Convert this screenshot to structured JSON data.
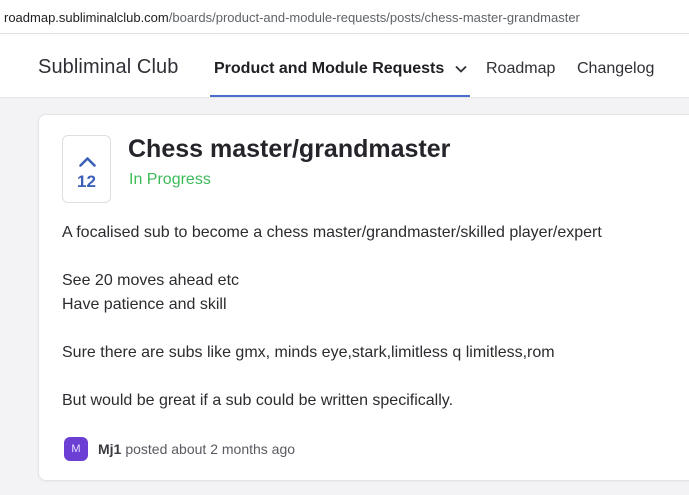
{
  "browser": {
    "url_host": "roadmap.subliminalclub.com",
    "url_path": "/boards/product-and-module-requests/posts/chess-master-grandmaster"
  },
  "nav": {
    "brand": "Subliminal Club",
    "items": [
      {
        "label": "Product and Module Requests",
        "active": true,
        "icon": "chevron-down-icon"
      },
      {
        "label": "Roadmap",
        "active": false
      },
      {
        "label": "Changelog",
        "active": false
      }
    ]
  },
  "post": {
    "votes": "12",
    "title": "Chess master/grandmaster",
    "status": "In Progress",
    "body": [
      "A focalised sub to become a chess master/grandmaster/skilled player/expert",
      "See 20 moves ahead etc",
      "Have patience and skill",
      "Sure there are subs like gmx, minds eye,stark,limitless q limitless,rom",
      "But would be great if a sub could be written specifically."
    ],
    "author": {
      "initial": "M",
      "name": "Mj1",
      "meta": "posted about 2 months ago"
    }
  },
  "colors": {
    "accent": "#4a6ec9",
    "vote_count": "#3c5fb7",
    "status": "#3dbb5b",
    "avatar": "#6b3fd4"
  }
}
